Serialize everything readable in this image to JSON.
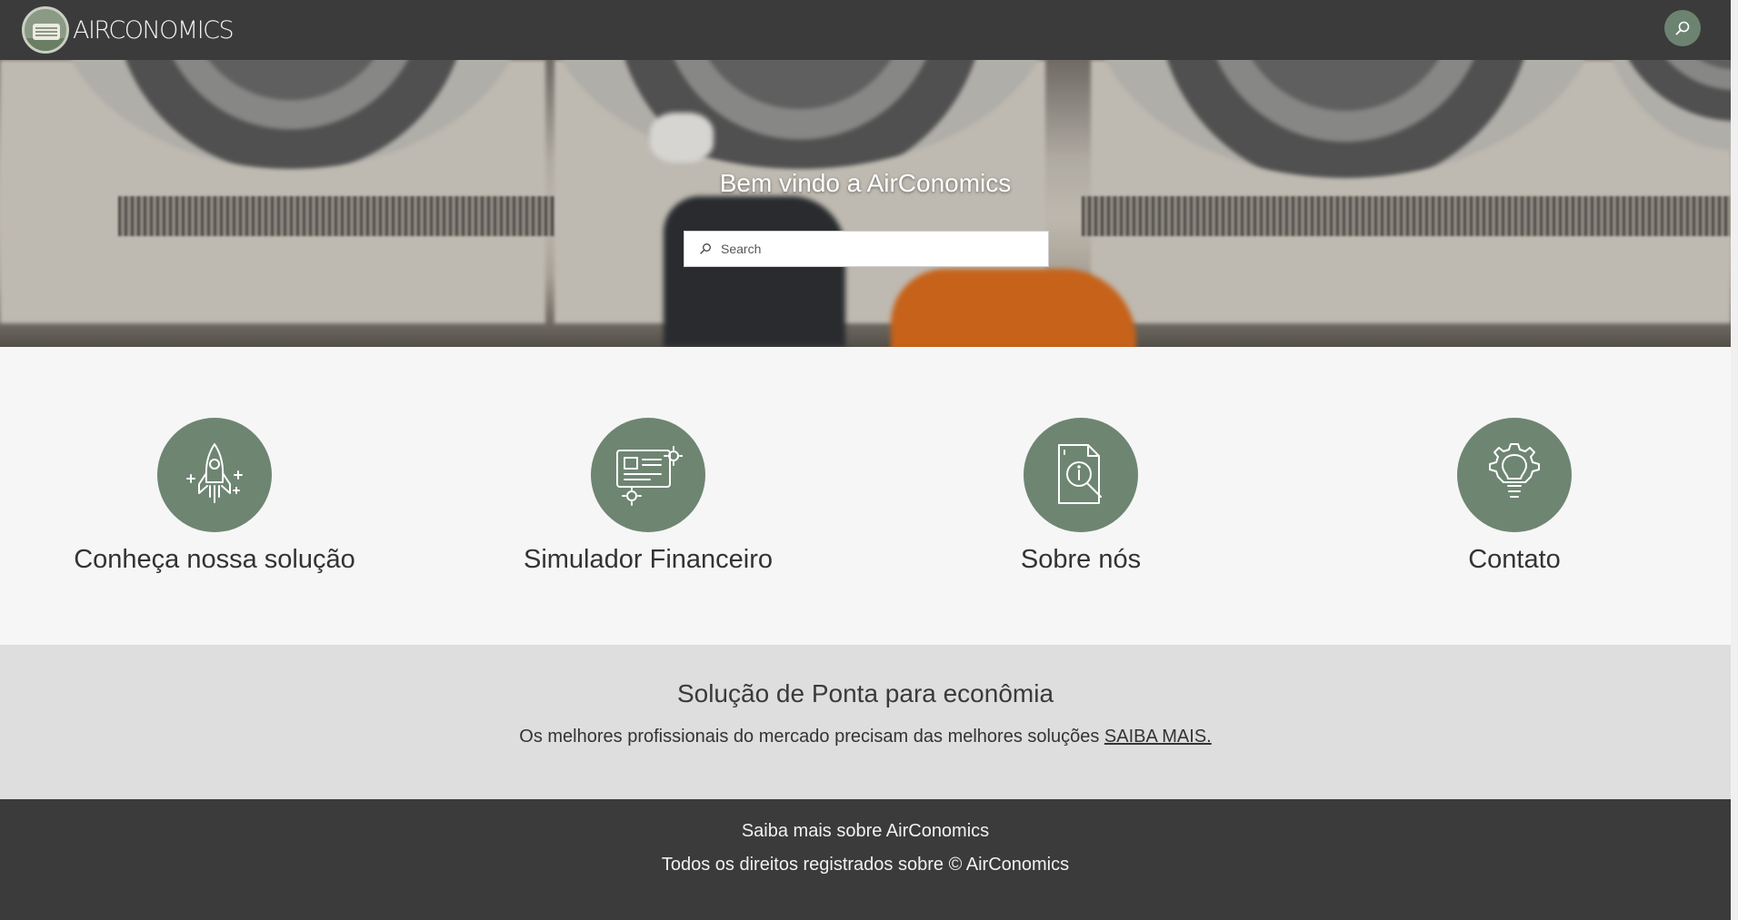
{
  "header": {
    "brand": "AIRCONOMICS",
    "search_icon": "search-icon",
    "colors": {
      "bar": "#3b3b3b",
      "accent": "#6e8572"
    }
  },
  "hero": {
    "title": "Bem vindo a AirConomics",
    "search_placeholder": "Search",
    "search_icon": "search-icon"
  },
  "cards": [
    {
      "label": "Conheça nossa solução",
      "icon": "rocket-icon"
    },
    {
      "label": "Simulador Financeiro",
      "icon": "calculator-gear-icon"
    },
    {
      "label": "Sobre nós",
      "icon": "document-info-icon"
    },
    {
      "label": "Contato",
      "icon": "lightbulb-gear-icon"
    }
  ],
  "promo": {
    "title": "Solução de Ponta para econômia",
    "text": "Os melhores profissionais do mercado precisam das melhores soluções",
    "link": "SAIBA MAIS."
  },
  "footer": {
    "line1": "Saiba mais sobre AirConomics",
    "line2": "Todos os direitos registrados sobre © AirConomics"
  }
}
